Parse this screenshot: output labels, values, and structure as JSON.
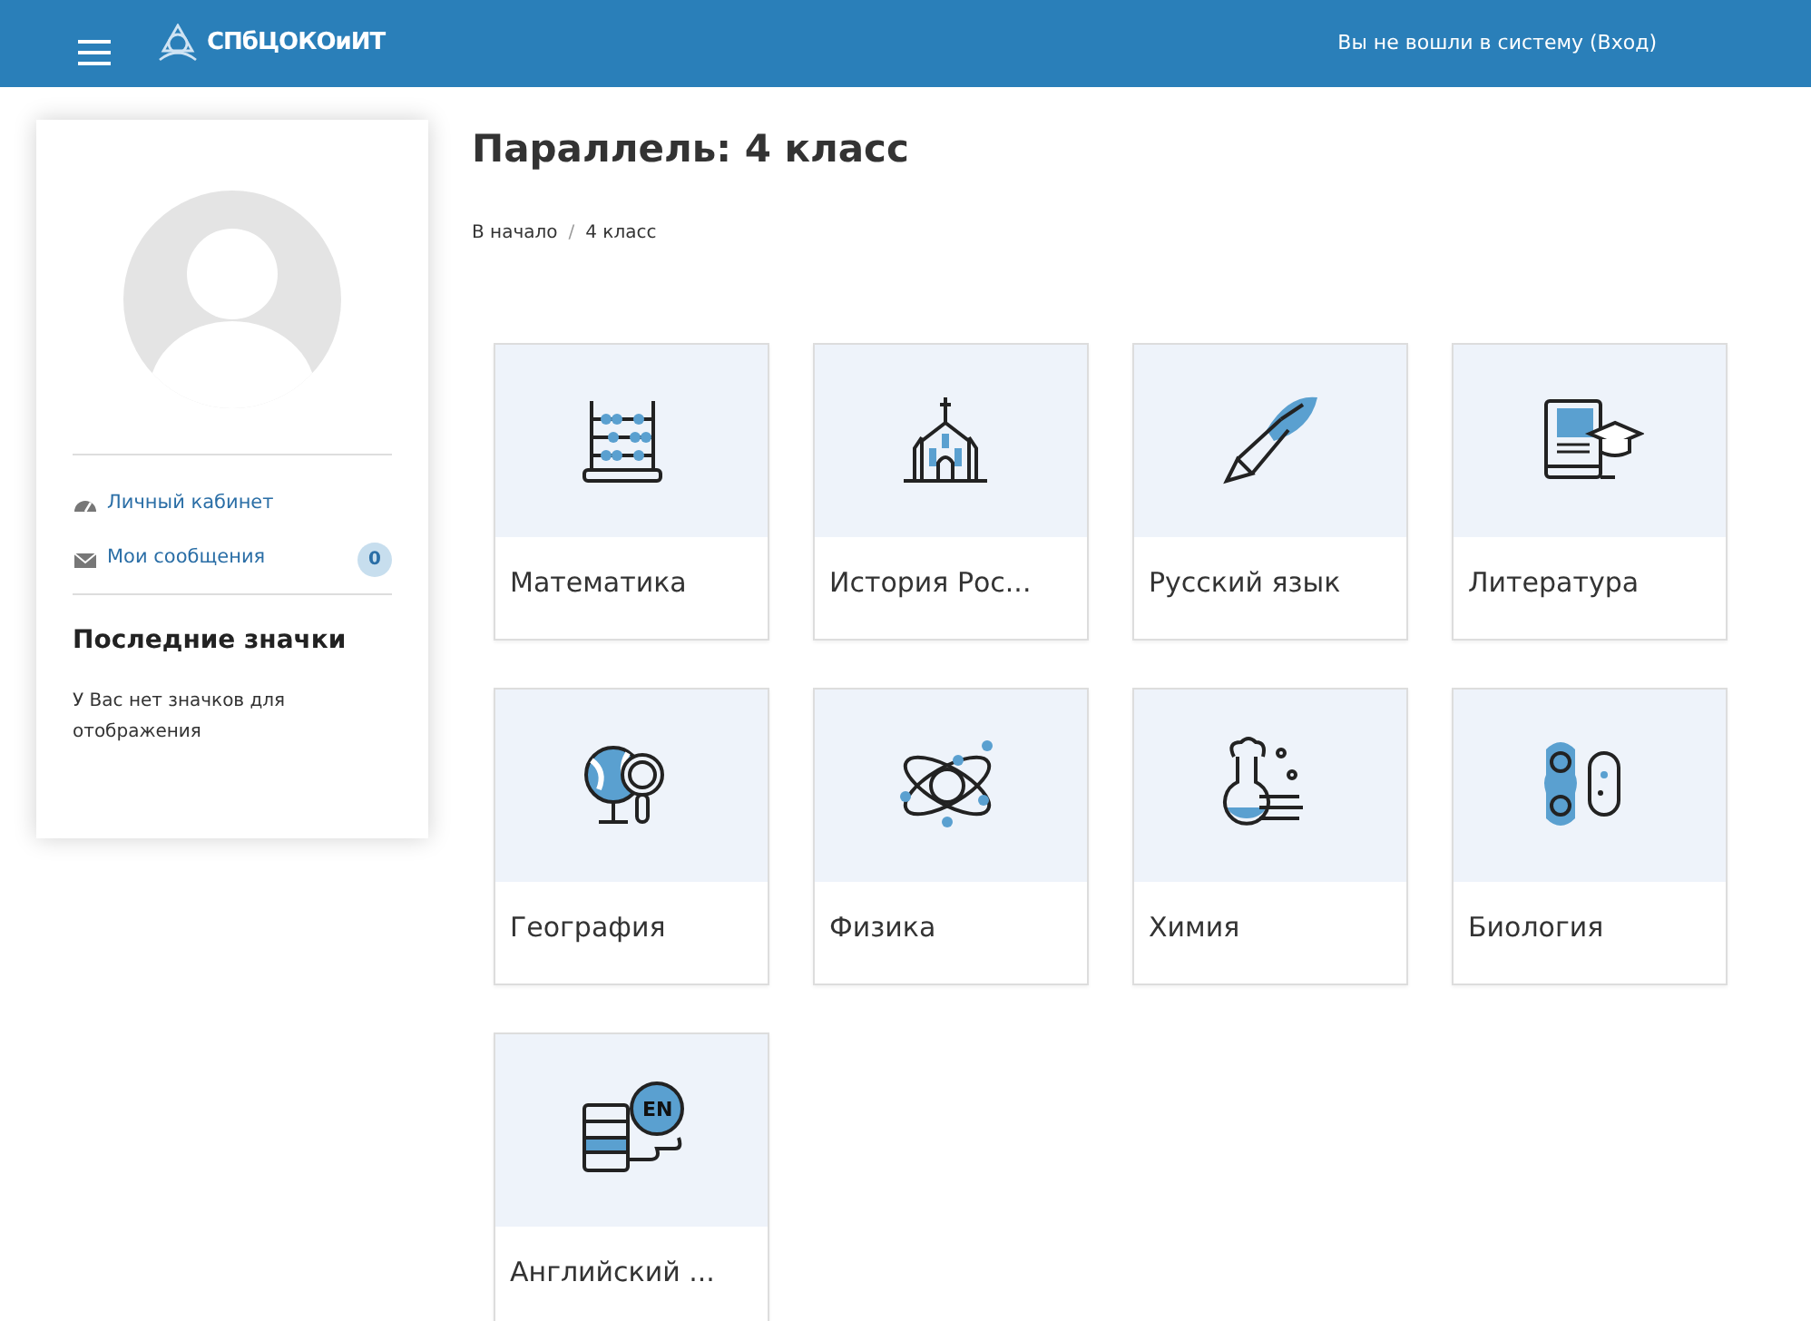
{
  "navbar": {
    "brand": "СПбЦОКОиИТ",
    "login_text": "Вы не вошли в систему (Вход)"
  },
  "sidebar": {
    "links": [
      {
        "label": "Личный кабинет"
      },
      {
        "label": "Мои сообщения",
        "badge": "0"
      }
    ],
    "badges_title": "Последние значки",
    "badges_text": "У Вас нет значков для отображения"
  },
  "page": {
    "title": "Параллель: 4 класс",
    "breadcrumb": [
      "В начало",
      "4 класс"
    ],
    "breadcrumb_separator": "/"
  },
  "courses": [
    {
      "name": "Математика"
    },
    {
      "name": "История Рос..."
    },
    {
      "name": "Русский язык"
    },
    {
      "name": "Литература"
    },
    {
      "name": "География"
    },
    {
      "name": "Физика"
    },
    {
      "name": "Химия"
    },
    {
      "name": "Биология"
    },
    {
      "name": "Английский ...",
      "icon_label": "EN"
    }
  ]
}
